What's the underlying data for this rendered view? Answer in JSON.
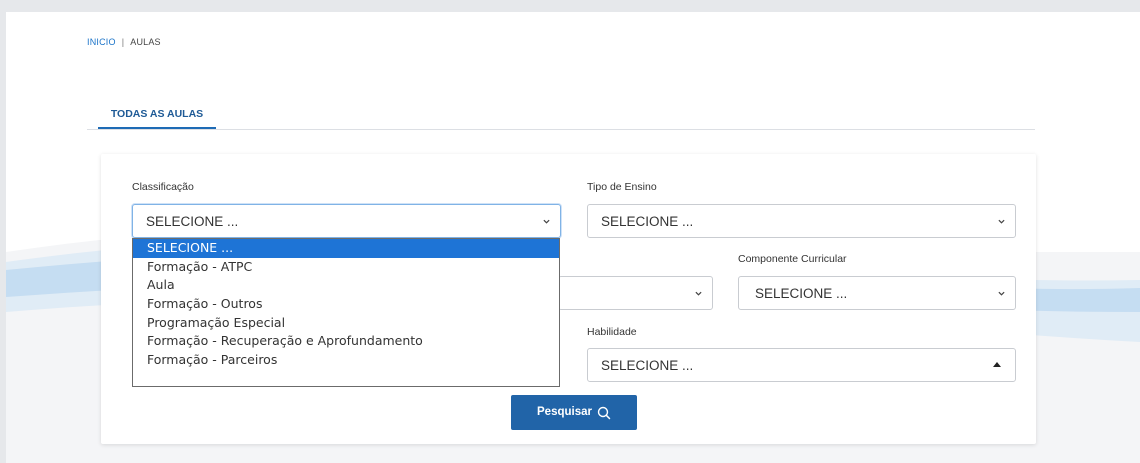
{
  "breadcrumb": {
    "home": "INICIO",
    "separator": "|",
    "current": "AULAS"
  },
  "tabs": [
    {
      "label": "TODAS AS AULAS",
      "active": true
    }
  ],
  "filters": {
    "classificacao": {
      "label": "Classificação",
      "value": "SELECIONE ..."
    },
    "tipo_ensino": {
      "label": "Tipo de Ensino",
      "value": "SELECIONE ..."
    },
    "hidden_middle": {
      "value": ""
    },
    "componente_curricular": {
      "label": "Componente Curricular",
      "value": "SELECIONE ..."
    },
    "habilidade": {
      "label": "Habilidade",
      "value": "SELECIONE ..."
    }
  },
  "dropdown": {
    "options": [
      "SELECIONE ...",
      "Formação - ATPC",
      "Aula",
      "Formação - Outros",
      "Programação Especial",
      "Formação - Recuperação e Aprofundamento",
      "Formação - Parceiros"
    ],
    "selected_index": 0
  },
  "search_button": {
    "label": "Pesquisar",
    "icon": "search-icon"
  },
  "colors": {
    "accent": "#1e6bb5",
    "button": "#2164a8",
    "highlight": "#1e74d6"
  }
}
